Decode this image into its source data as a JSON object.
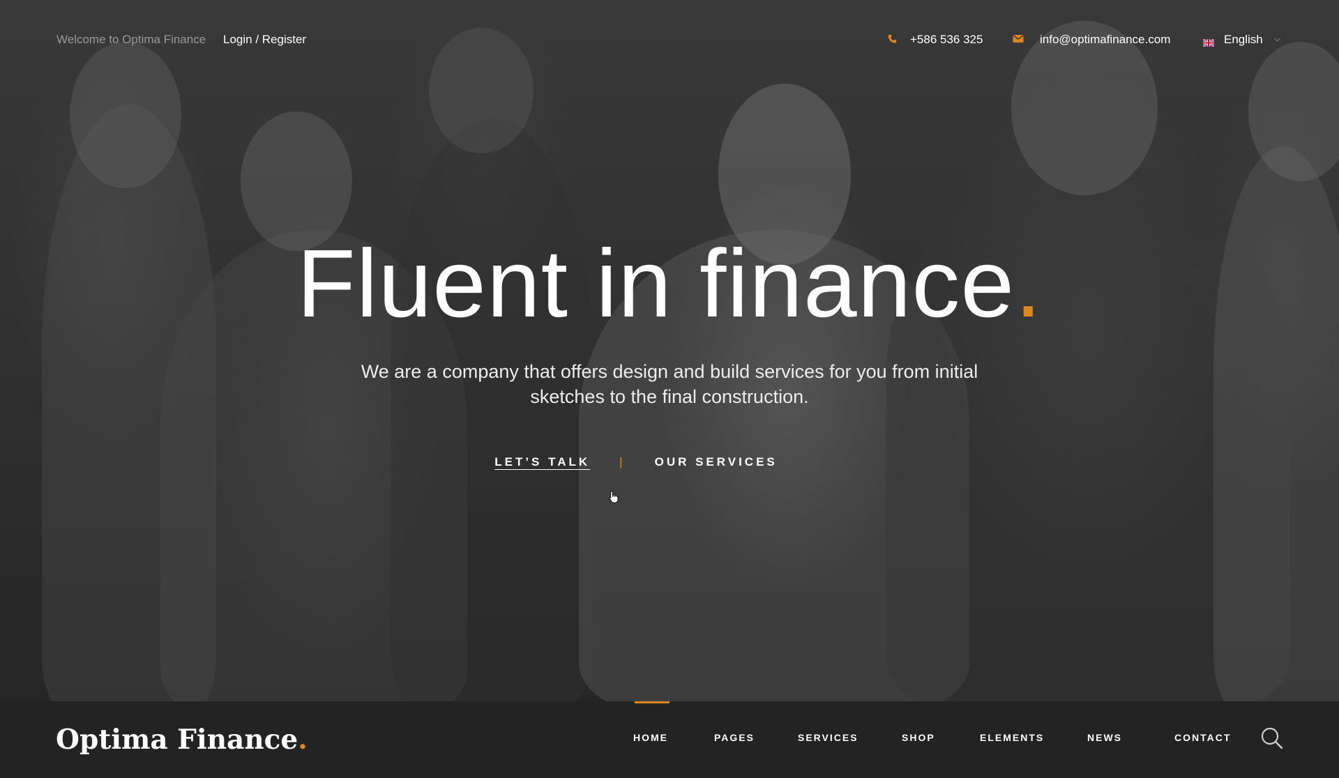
{
  "topbar": {
    "welcome": "Welcome to Optima Finance",
    "login": "Login / Register",
    "phone": "+586 536 325",
    "email": "info@optimafinance.com",
    "language": "English"
  },
  "hero": {
    "headline": "Fluent in finance",
    "headline_dot": ".",
    "subtitle": "We are a company that offers design and build services for you from initial sketches to the final construction.",
    "cta_primary": "LET’S TALK",
    "cta_separator": "|",
    "cta_secondary": "OUR SERVICES"
  },
  "navbar": {
    "logo": "Optima Finance",
    "logo_dot": ".",
    "items": [
      {
        "label": "HOME",
        "active": true
      },
      {
        "label": "PAGES"
      },
      {
        "label": "SERVICES"
      },
      {
        "label": "SHOP"
      },
      {
        "label": "ELEMENTS"
      },
      {
        "label": "NEWS"
      },
      {
        "label": "CONTACT"
      }
    ]
  },
  "icons": {
    "phone": "phone-icon",
    "email": "mail-icon",
    "language": "uk-flag-icon",
    "search": "search-icon",
    "dropdown": "chevron-down-icon"
  },
  "colors": {
    "accent": "#e0861e",
    "navbar_bg": "#232323",
    "text": "#ffffff"
  }
}
